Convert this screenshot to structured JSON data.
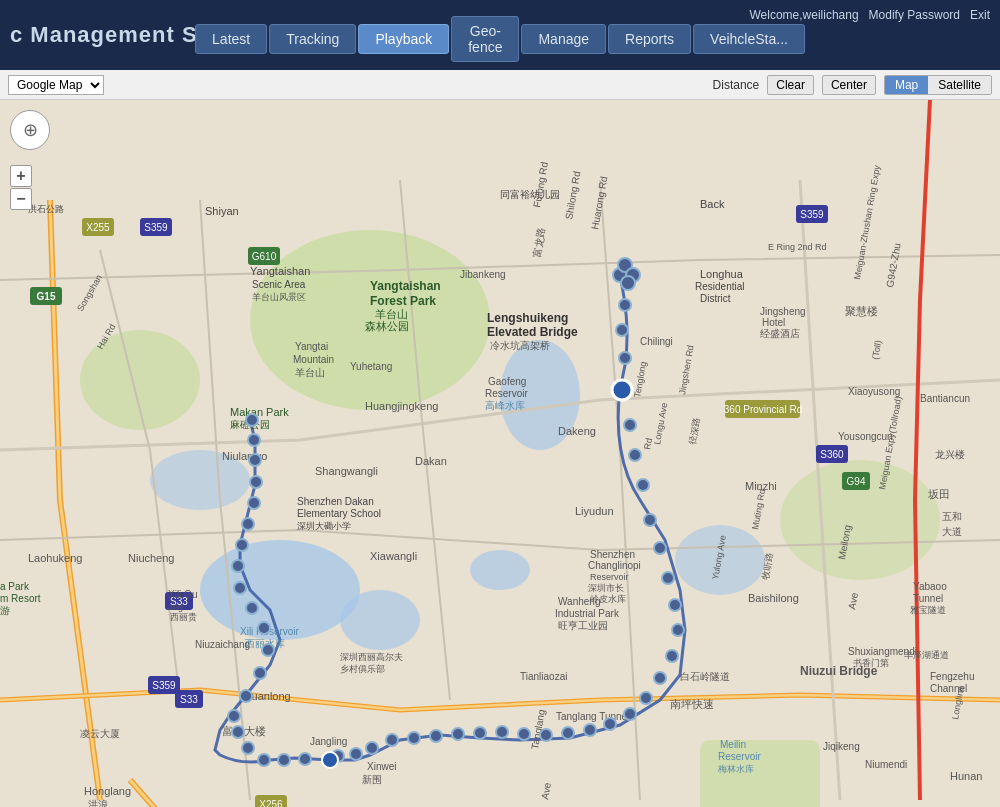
{
  "header": {
    "title": "c Management System",
    "welcome": "Welcome,weilichang",
    "links": [
      "Modify Password",
      "Exit"
    ]
  },
  "nav": {
    "items": [
      {
        "label": "Latest",
        "active": false
      },
      {
        "label": "Tracking",
        "active": false
      },
      {
        "label": "Playback",
        "active": true
      },
      {
        "label": "Geo-fence",
        "active": false
      },
      {
        "label": "Manage",
        "active": false
      },
      {
        "label": "Reports",
        "active": false
      },
      {
        "label": "VeihcleSta...",
        "active": false
      }
    ]
  },
  "toolbar": {
    "map_type_label": "Google Map",
    "distance_label": "Distance",
    "clear_label": "Clear",
    "center_label": "Center",
    "map_btn": "Map",
    "satellite_btn": "Satellite"
  },
  "map": {
    "type": "Google Map"
  }
}
